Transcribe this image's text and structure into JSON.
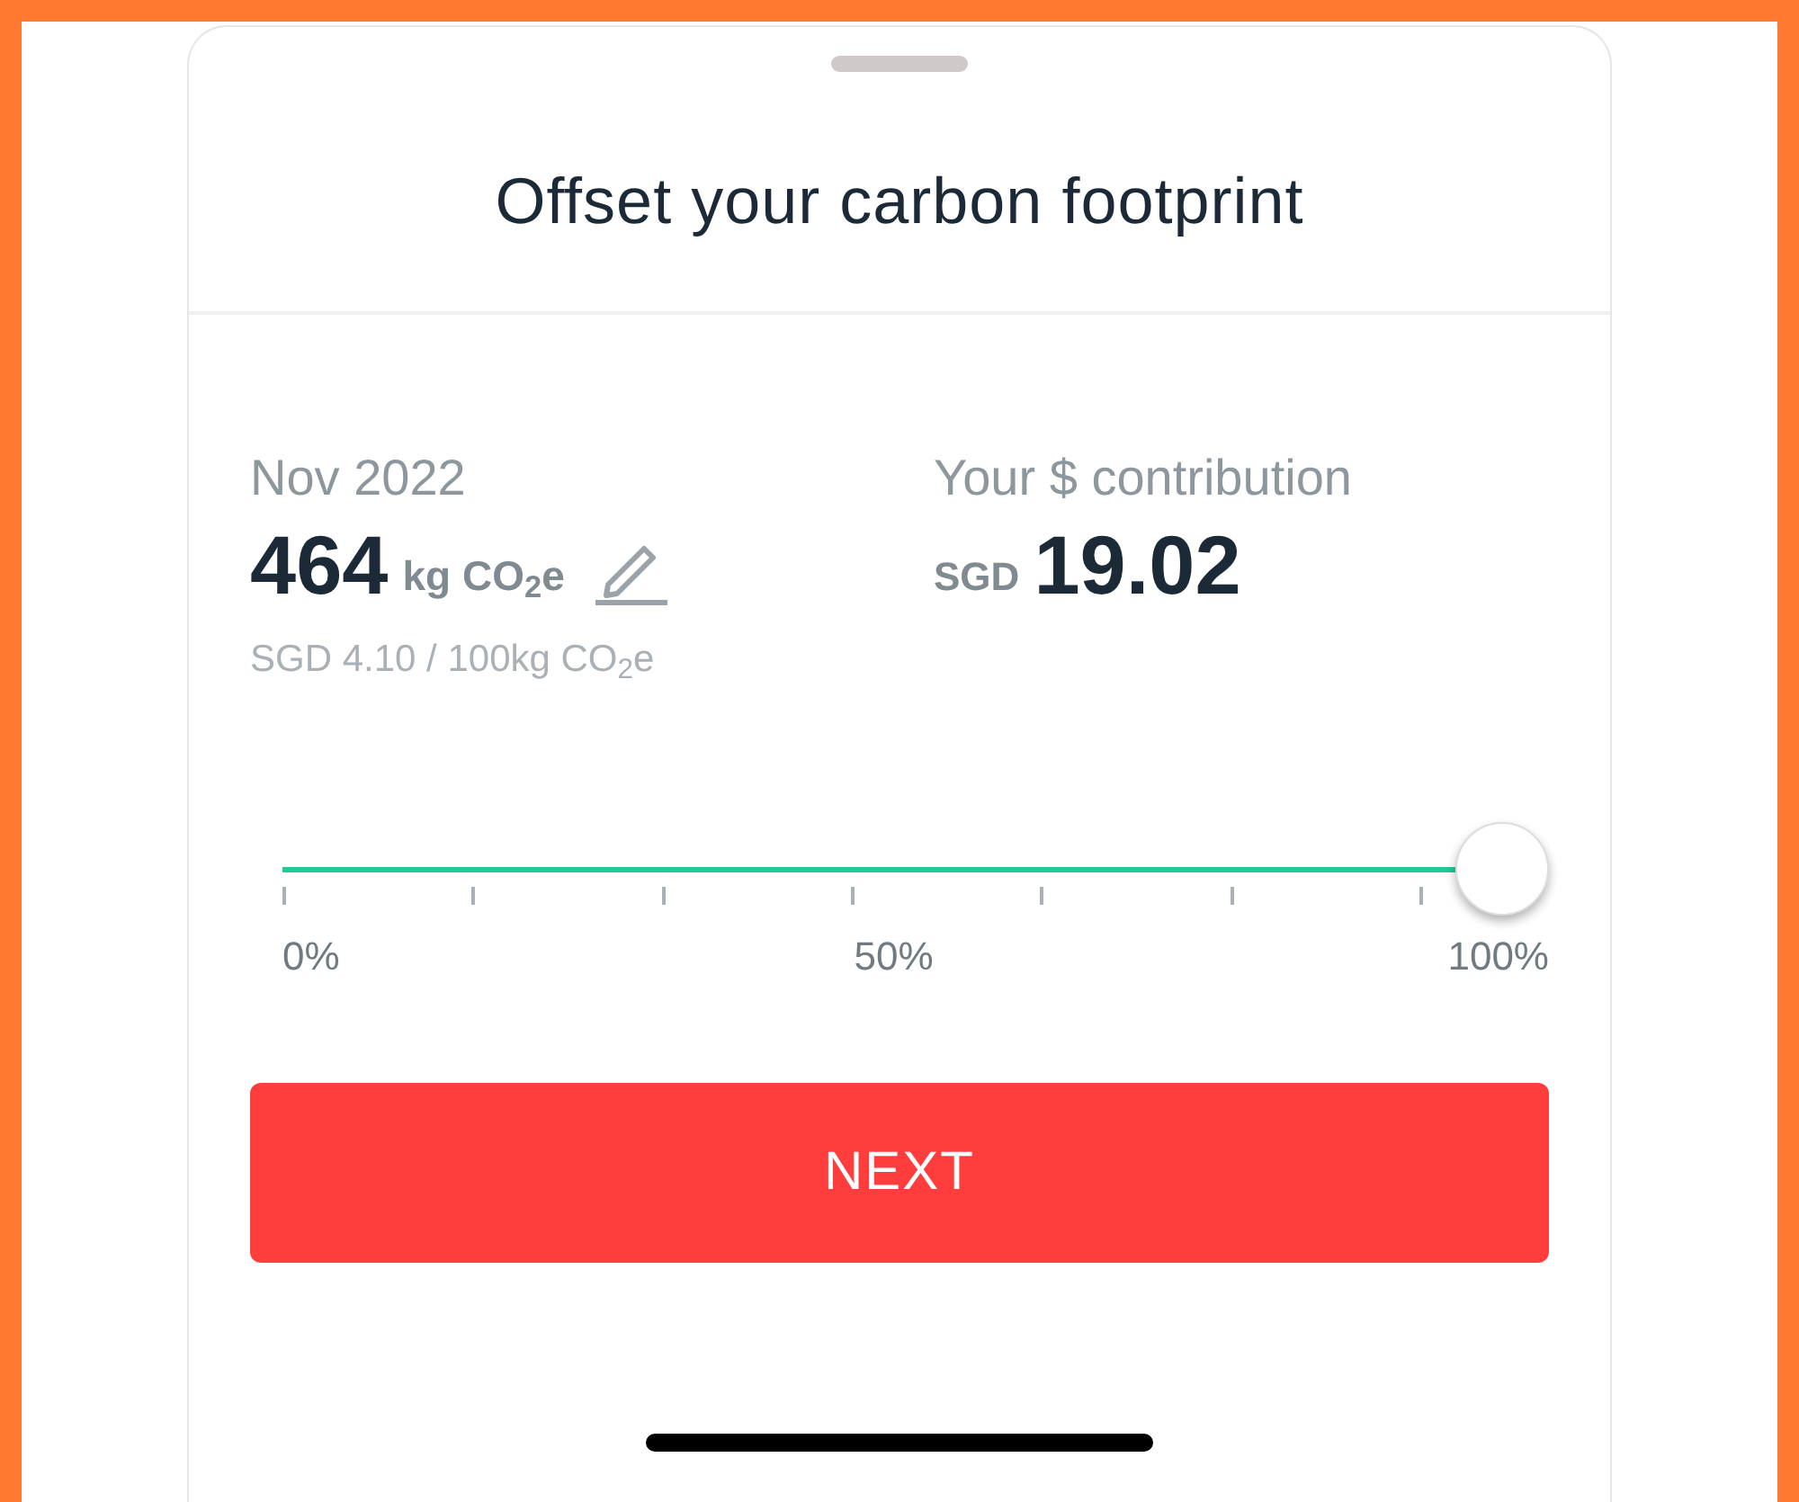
{
  "title": "Offset your carbon footprint",
  "period": "Nov 2022",
  "amount": "464",
  "unit": "kg CO$_{2}$e",
  "rate": "SGD 4.10 / 100kg CO$_{2}$e",
  "contribution_label": "Your $ contribution",
  "currency": "SGD",
  "contribution": "19.02",
  "slider": {
    "level": 1,
    "labels": [
      "0%",
      "50%",
      "100%"
    ]
  },
  "button": "NEXT"
}
